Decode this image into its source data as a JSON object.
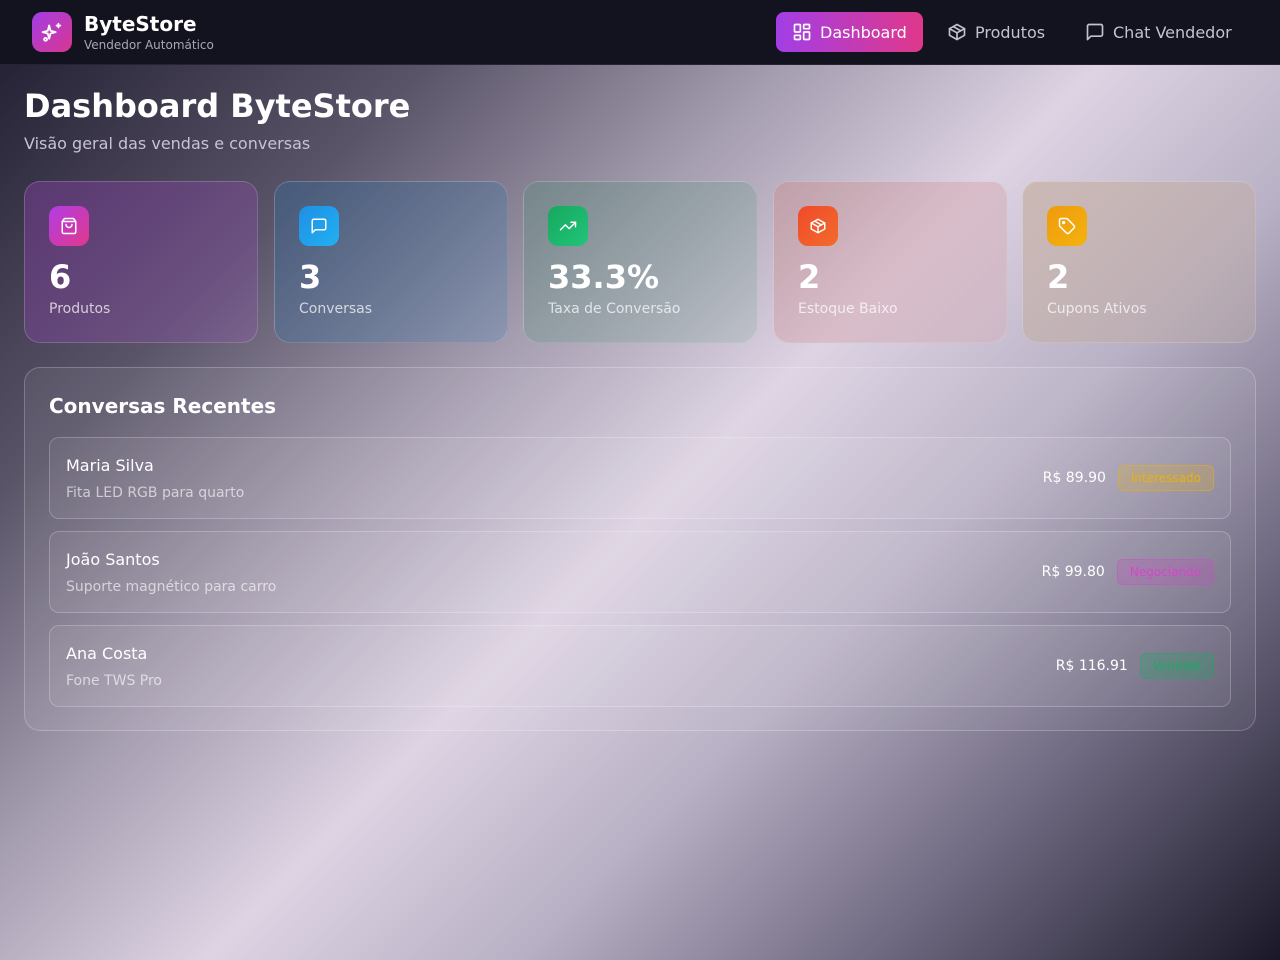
{
  "header": {
    "brand_name": "ByteStore",
    "brand_subtitle": "Vendedor Automático",
    "nav": [
      {
        "label": "Dashboard",
        "icon": "layout-grid-icon",
        "active": true
      },
      {
        "label": "Produtos",
        "icon": "package-icon",
        "active": false
      },
      {
        "label": "Chat Vendedor",
        "icon": "message-square-icon",
        "active": false
      }
    ]
  },
  "page": {
    "title": "Dashboard ByteStore",
    "subtitle": "Visão geral das vendas e conversas"
  },
  "stats": [
    {
      "value": "6",
      "label": "Produtos",
      "icon": "shopping-bag-icon",
      "color": "#c13fd6"
    },
    {
      "value": "3",
      "label": "Conversas",
      "icon": "message-square-icon",
      "color": "#1f9be6"
    },
    {
      "value": "33.3%",
      "label": "Taxa de Conversão",
      "icon": "trending-up-icon",
      "color": "#1fb86a"
    },
    {
      "value": "2",
      "label": "Estoque Baixo",
      "icon": "package-icon",
      "color": "#f0522a"
    },
    {
      "value": "2",
      "label": "Cupons Ativos",
      "icon": "tag-icon",
      "color": "#f0a00c"
    }
  ],
  "recent_conversations": {
    "title": "Conversas Recentes",
    "items": [
      {
        "name": "Maria Silva",
        "product": "Fita LED RGB para quarto",
        "price": "R$ 89.90",
        "status": "Interessado",
        "status_color": "#e8b20c"
      },
      {
        "name": "João Santos",
        "product": "Suporte magnético para carro",
        "price": "R$ 99.80",
        "status": "Negociando",
        "status_color": "#d346c9"
      },
      {
        "name": "Ana Costa",
        "product": "Fone TWS Pro",
        "price": "R$ 116.91",
        "status": "Vendido",
        "status_color": "#1fa863"
      }
    ]
  }
}
